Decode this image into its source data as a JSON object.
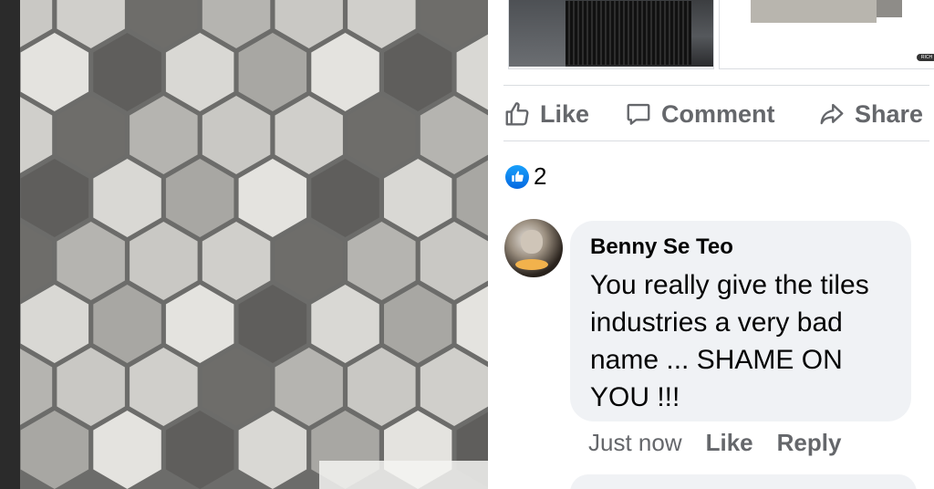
{
  "post": {
    "actions": {
      "like_label": "Like",
      "comment_label": "Comment",
      "share_label": "Share"
    },
    "reactions": {
      "count": "2",
      "icon": "thumbs-up-icon"
    },
    "thumbnail_logo_text": "RICH"
  },
  "comment": {
    "author": "Benny Se Teo",
    "text": "You really give the tiles industries a very bad name ... SHAME ON YOU !!!",
    "time": "Just now",
    "like_label": "Like",
    "reply_label": "Reply"
  },
  "colors": {
    "accent": "#0668e1",
    "text_primary": "#050505",
    "text_secondary": "#65676b",
    "bubble_bg": "#f0f2f5"
  }
}
